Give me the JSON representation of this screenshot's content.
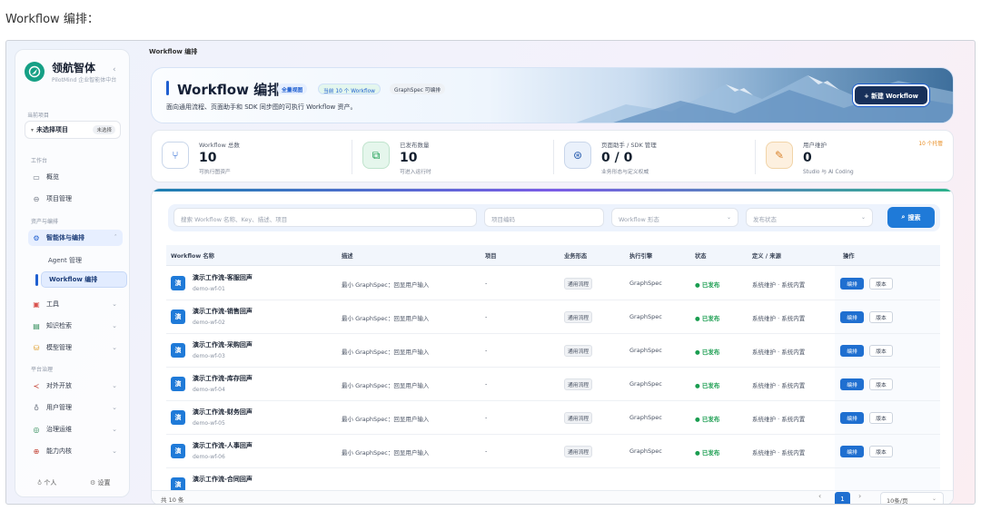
{
  "doc_title": "Workflow 编排：",
  "sidebar": {
    "brand": "领航智体",
    "brand_sub": "PilotMind 企业智能体中台",
    "collapse_icon": "chevron-left-icon",
    "current_project_label": "当前项目",
    "project_value": "未选择项目",
    "project_badge": "未选择",
    "sections": {
      "workbench": "工作台",
      "assets": "资产与编排",
      "governance": "平台治理"
    },
    "items": [
      {
        "label": "概览",
        "icon": "monitor-icon"
      },
      {
        "label": "项目管理",
        "icon": "link-icon"
      },
      {
        "label": "智能体与编排",
        "icon": "gear-icon"
      },
      {
        "label": "工具",
        "icon": "toolbox-icon"
      },
      {
        "label": "知识检索",
        "icon": "book-icon"
      },
      {
        "label": "模型管理",
        "icon": "database-icon"
      },
      {
        "label": "对外开放",
        "icon": "share-icon"
      },
      {
        "label": "用户管理",
        "icon": "user-icon"
      },
      {
        "label": "治理运维",
        "icon": "compass-icon"
      },
      {
        "label": "能力内核",
        "icon": "globe-icon"
      }
    ],
    "sub_items": [
      "Agent 管理",
      "Workflow 编排"
    ],
    "footer": {
      "personal": "个人",
      "settings": "设置"
    }
  },
  "breadcrumb": "Workflow 编排",
  "hero": {
    "title": "Workflow 编排",
    "chips": [
      "全量视图",
      "当前 10 个 Workflow",
      "GraphSpec 可编排"
    ],
    "subtitle": "面向通用流程、页面助手和 SDK 同步图的可执行 Workflow 资产。",
    "new_button": "+ 新建 Workflow"
  },
  "stats": [
    {
      "label": "Workflow 总数",
      "value": "10",
      "sub": "可执行图资产",
      "icon": "workflow-icon"
    },
    {
      "label": "已发布数量",
      "value": "10",
      "sub": "可进入运行时",
      "icon": "nodes-icon"
    },
    {
      "label": "页面助手 / SDK 管理",
      "value": "0 / 0",
      "sub": "业务形态与定义权威",
      "icon": "cluster-icon"
    },
    {
      "label": "用户维护",
      "value": "0",
      "sub": "Studio 与 AI Coding",
      "icon": "edit-doc-icon",
      "badge": "10 个托管"
    }
  ],
  "filters": {
    "search_placeholder": "搜索 Workflow 名称、Key、描述、项目",
    "project_code_placeholder": "项目编码",
    "form_placeholder": "Workflow 形态",
    "status_placeholder": "发布状态",
    "search_button": "搜索"
  },
  "table": {
    "headers": [
      "Workflow 名称",
      "描述",
      "项目",
      "业务形态",
      "执行引擎",
      "状态",
      "定义 / 来源",
      "操作"
    ],
    "rows": [
      {
        "name": "演示工作流-客服回声",
        "key": "demo-wf-01",
        "desc": "最小 GraphSpec：回显用户输入",
        "project": "-",
        "form": "通用流程",
        "engine": "GraphSpec",
        "status": "● 已发布",
        "source": "系统维护 · 系统内置",
        "edit": "编排",
        "version": "版本",
        "icon": "演"
      },
      {
        "name": "演示工作流-销售回声",
        "key": "demo-wf-02",
        "desc": "最小 GraphSpec：回显用户输入",
        "project": "-",
        "form": "通用流程",
        "engine": "GraphSpec",
        "status": "● 已发布",
        "source": "系统维护 · 系统内置",
        "edit": "编排",
        "version": "版本",
        "icon": "演"
      },
      {
        "name": "演示工作流-采购回声",
        "key": "demo-wf-03",
        "desc": "最小 GraphSpec：回显用户输入",
        "project": "-",
        "form": "通用流程",
        "engine": "GraphSpec",
        "status": "● 已发布",
        "source": "系统维护 · 系统内置",
        "edit": "编排",
        "version": "版本",
        "icon": "演"
      },
      {
        "name": "演示工作流-库存回声",
        "key": "demo-wf-04",
        "desc": "最小 GraphSpec：回显用户输入",
        "project": "-",
        "form": "通用流程",
        "engine": "GraphSpec",
        "status": "● 已发布",
        "source": "系统维护 · 系统内置",
        "edit": "编排",
        "version": "版本",
        "icon": "演"
      },
      {
        "name": "演示工作流-财务回声",
        "key": "demo-wf-05",
        "desc": "最小 GraphSpec：回显用户输入",
        "project": "-",
        "form": "通用流程",
        "engine": "GraphSpec",
        "status": "● 已发布",
        "source": "系统维护 · 系统内置",
        "edit": "编排",
        "version": "版本",
        "icon": "演"
      },
      {
        "name": "演示工作流-人事回声",
        "key": "demo-wf-06",
        "desc": "最小 GraphSpec：回显用户输入",
        "project": "-",
        "form": "通用流程",
        "engine": "GraphSpec",
        "status": "● 已发布",
        "source": "系统维护 · 系统内置",
        "edit": "编排",
        "version": "版本",
        "icon": "演"
      },
      {
        "name": "演示工作流-合同回声",
        "key": "",
        "desc": "",
        "project": "",
        "form": "",
        "engine": "",
        "status": "",
        "source": "",
        "edit": "",
        "version": "",
        "icon": "演"
      }
    ]
  },
  "pagination": {
    "total": "共 10 条",
    "current_page": "1",
    "per_page": "10条/页"
  },
  "colors": {
    "accent": "#1f6fd0",
    "published": "#1a9d50",
    "badge": "#e8891a"
  }
}
